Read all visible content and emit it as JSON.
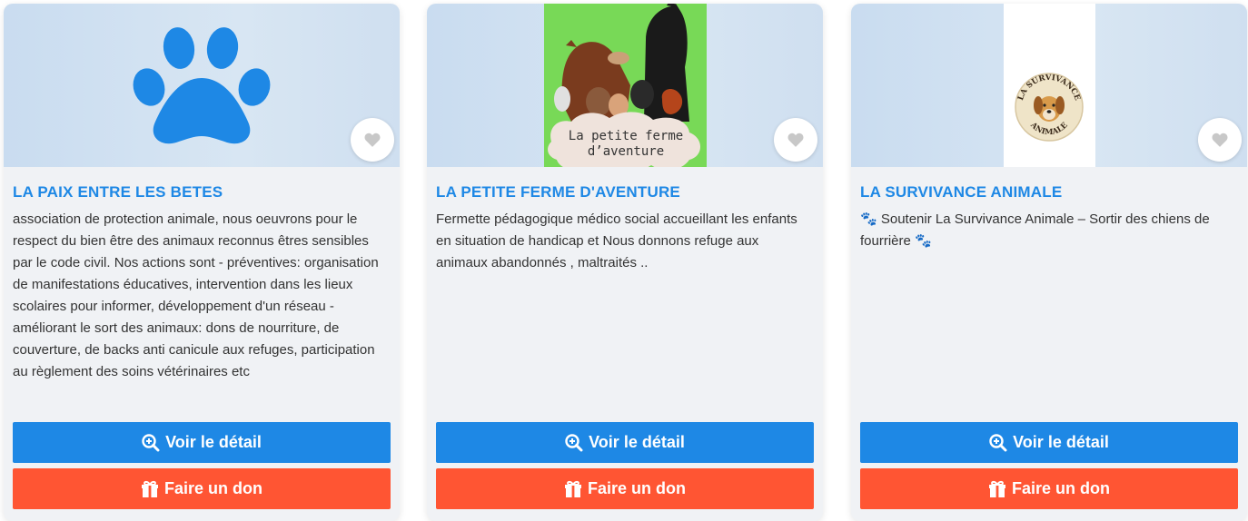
{
  "cards": [
    {
      "title": "LA PAIX ENTRE LES BETES",
      "description": "association de protection animale, nous oeuvrons pour le respect du bien être des animaux reconnus êtres sensibles par le code civil. Nos actions sont - préventives: organisation de manifestations éducatives, intervention dans les lieux scolaires pour informer, développement d'un réseau - améliorant le sort des animaux: dons de nourriture, de couverture, de backs anti canicule aux refuges, participation au règlement des soins vétérinaires etc",
      "image_icon": "paw-icon",
      "detail_label": "Voir le détail",
      "donate_label": "Faire un don"
    },
    {
      "title": "LA PETITE FERME D'AVENTURE",
      "description": "Fermette pédagogique médico social accueillant les enfants en situation de handicap et Nous donnons refuge aux animaux abandonnés , maltraités ..",
      "logo_line1": "La petite ferme",
      "logo_line2": "d’aventure",
      "detail_label": "Voir le détail",
      "donate_label": "Faire un don"
    },
    {
      "title": "LA SURVIVANCE ANIMALE",
      "description": "🐾 Soutenir La Survivance Animale – Sortir des chiens de fourrière 🐾",
      "logo_top": "LA SURVIVANCE",
      "logo_bottom": "ANIMALE",
      "detail_label": "Voir le détail",
      "donate_label": "Faire un don"
    }
  ],
  "colors": {
    "title": "#1e88e5",
    "detail_button": "#1e88e5",
    "donate_button": "#ff5533",
    "paw": "#1e88e5",
    "card_bg": "#f0f2f5"
  },
  "icons": {
    "favorite": "heart-icon",
    "detail": "search-plus-icon",
    "donate": "gift-icon"
  }
}
